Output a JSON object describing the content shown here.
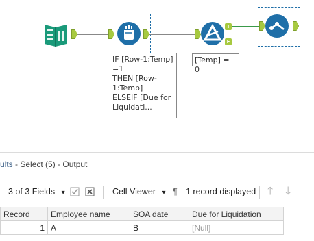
{
  "annotations": {
    "formula": [
      "IF [Row-1:Temp]",
      "=1",
      "THEN [Row-",
      "1:Temp]",
      "ELSEIF [Due for",
      "Liquidati..."
    ],
    "filter": "[Temp] = 0"
  },
  "filter_outputs": {
    "true_label": "T",
    "false_label": "F"
  },
  "results": {
    "title_prefix": "ults",
    "title_suffix": " - Select (5) - Output"
  },
  "toolbar": {
    "fields_label": "3 of 3 Fields",
    "viewer_label": "Cell Viewer",
    "record_count": "1 record displayed",
    "pilcrow": "¶",
    "dropdown_glyph": "▾",
    "up_glyph": "🡑",
    "down_glyph": "🡓"
  },
  "grid": {
    "columns": [
      "Record",
      "Employee name",
      "SOA date",
      "Due for Liquidation"
    ],
    "rows": [
      [
        "1",
        "A",
        "B",
        "[Null]"
      ]
    ]
  },
  "colors": {
    "accent": "#1f6fa8",
    "book_green": "#1a9a7a",
    "anchor_green": "#a7c940"
  }
}
